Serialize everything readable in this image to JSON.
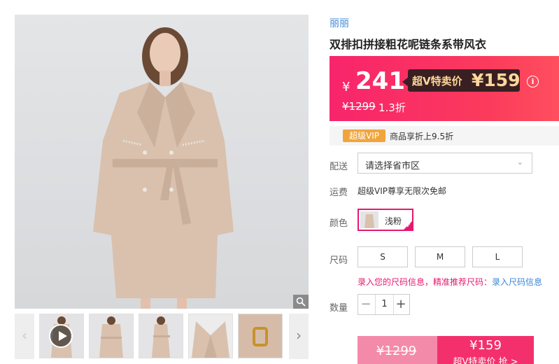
{
  "product": {
    "brand": "丽丽",
    "title": "双排扣拼接粗花呢链条系带风衣"
  },
  "price": {
    "currency": "¥",
    "current": "241",
    "vip_label": "超V特卖价",
    "vip_price": "¥159",
    "original": "¥1299",
    "discount": "1.3折",
    "info_icon": "info-icon"
  },
  "vip_strip": {
    "badge": "超级VIP",
    "text": "商品享折上9.5折"
  },
  "delivery": {
    "label": "配送",
    "placeholder": "请选择省市区"
  },
  "shipping": {
    "label": "运费",
    "text": "超级VIP尊享无限次免邮"
  },
  "color": {
    "label": "颜色",
    "selected": "浅粉"
  },
  "size": {
    "label": "尺码",
    "options": [
      "S",
      "M",
      "L"
    ],
    "hint_pink": "录入您的尺码信息，精准推荐尺码：",
    "hint_link": "录入尺码信息"
  },
  "quantity": {
    "label": "数量",
    "value": "1",
    "minus": "−",
    "plus": "+"
  },
  "buy": {
    "left_price": "¥1299",
    "right_price": "¥159",
    "right_label": "超V特卖价 抢 >"
  },
  "gallery": {
    "zoom_icon": "magnifier-icon",
    "prev_arrow": "‹",
    "next_arrow": "›"
  },
  "colors": {
    "accent": "#e6186f",
    "price_bg_start": "#f8246c",
    "price_bg_end": "#ff4f5e",
    "vip_gold": "#ffd89a",
    "vip_badge": "#f0a53c",
    "link_blue": "#3b86d6"
  }
}
